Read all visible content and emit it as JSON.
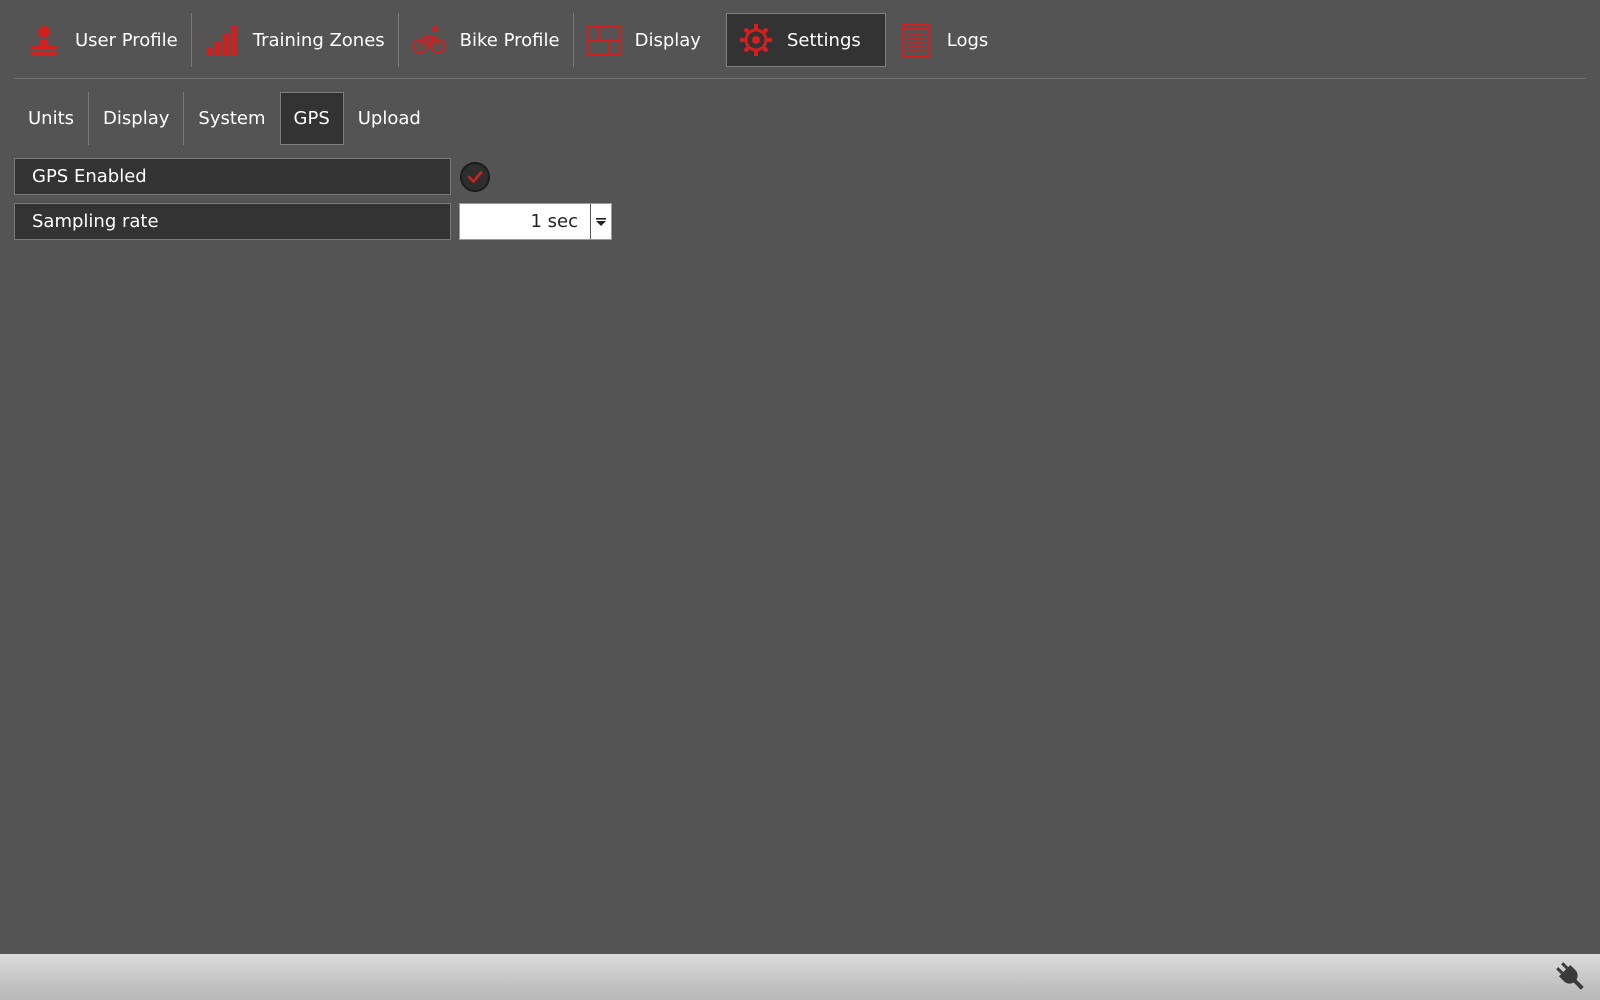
{
  "main_nav": {
    "tabs": [
      {
        "label": "User Profile",
        "icon": "user-icon"
      },
      {
        "label": "Training Zones",
        "icon": "bar-chart-icon"
      },
      {
        "label": "Bike Profile",
        "icon": "bike-icon"
      },
      {
        "label": "Display",
        "icon": "display-grid-icon"
      },
      {
        "label": "Settings",
        "icon": "gear-icon",
        "active": true
      },
      {
        "label": "Logs",
        "icon": "log-list-icon"
      }
    ]
  },
  "sub_nav": {
    "tabs": [
      {
        "label": "Units"
      },
      {
        "label": "Display"
      },
      {
        "label": "System"
      },
      {
        "label": "GPS",
        "active": true
      },
      {
        "label": "Upload"
      }
    ]
  },
  "settings": {
    "gps_enabled": {
      "label": "GPS Enabled",
      "checked": true
    },
    "sampling_rate": {
      "label": "Sampling rate",
      "value": "1 sec"
    }
  },
  "status_bar": {
    "icon": "plug-connection-icon"
  },
  "colors": {
    "background": "#545454",
    "accent": "#d02020",
    "active_tab": "#333333",
    "status_bar": "#c8c8c8"
  }
}
